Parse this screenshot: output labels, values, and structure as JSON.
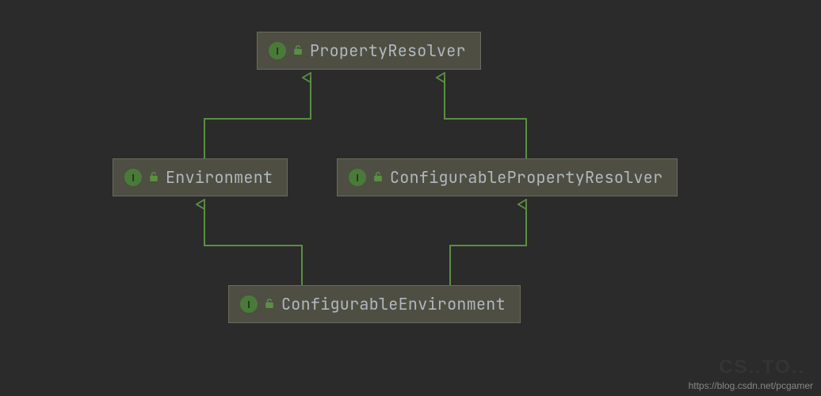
{
  "diagram": {
    "nodes": {
      "propertyResolver": {
        "label": "PropertyResolver",
        "badge": "I",
        "kind": "interface"
      },
      "environment": {
        "label": "Environment",
        "badge": "I",
        "kind": "interface"
      },
      "configurablePropertyResolver": {
        "label": "ConfigurablePropertyResolver",
        "badge": "I",
        "kind": "interface"
      },
      "configurableEnvironment": {
        "label": "ConfigurableEnvironment",
        "badge": "I",
        "kind": "interface"
      }
    },
    "edges": [
      {
        "from": "environment",
        "to": "propertyResolver"
      },
      {
        "from": "configurablePropertyResolver",
        "to": "propertyResolver"
      },
      {
        "from": "configurableEnvironment",
        "to": "environment"
      },
      {
        "from": "configurableEnvironment",
        "to": "configurablePropertyResolver"
      }
    ],
    "colors": {
      "background": "#2b2b2b",
      "nodeFill": "#4e4e42",
      "nodeBorder": "#6a6a5e",
      "arrow": "#5a8f42",
      "text": "#b0b8c0",
      "badgeFill": "#4a7a3a"
    }
  },
  "watermark": {
    "url": "https://blog.csdn.net/pcgamer",
    "faint": "CS..TO.."
  }
}
